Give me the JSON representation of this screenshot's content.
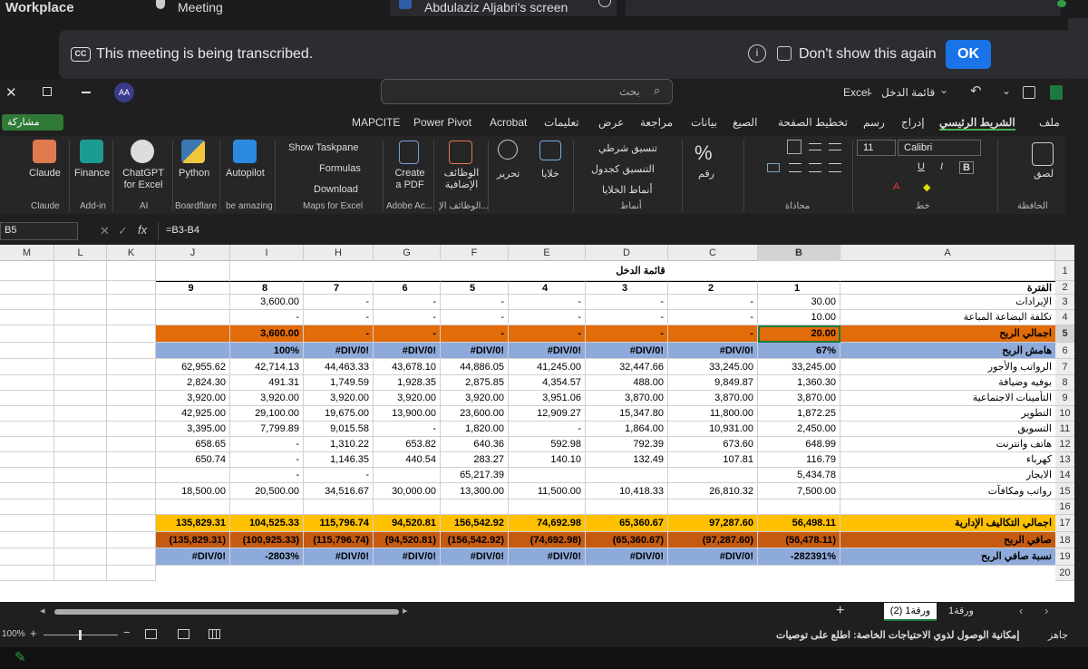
{
  "meeting": {
    "app_title": "Workplace",
    "tab1": "Meeting",
    "tab2": "Abdulaziz Aljabri's screen",
    "banner_text": "This meeting is being transcribed.",
    "cc_badge": "CC",
    "dont_show": "Don't show this again",
    "ok": "OK"
  },
  "excel": {
    "file_title": "قائمة الدخل",
    "app_name": "Excel",
    "search_placeholder": "بحث",
    "avatar": "AA",
    "share": "مشاركة",
    "menu": [
      "ملف",
      "الشريط الرئيسي",
      "إدراج",
      "رسم",
      "تخطيط الصفحة",
      "الصيغ",
      "بيانات",
      "مراجعة",
      "عرض",
      "تعليمات",
      "Acrobat",
      "Power Pivot",
      "MAPCITE"
    ],
    "ribbon": {
      "claude": "Claude",
      "finance": "Finance",
      "chatgpt": "ChatGPT for Excel",
      "python": "Python",
      "autopilot": "Autopilot",
      "show_taskpane": "Show Taskpane",
      "formulas": "Formulas",
      "download": "Download",
      "create_pdf": "Create a PDF",
      "addins": "الوظائف الإضافية",
      "edit": "تحرير",
      "cells": "خلايا",
      "cond_format": "تنسيق شرطي",
      "format_table": "التنسيق كجدول",
      "cell_styles": "أنماط الخلايا",
      "number": "رقم",
      "paste": "لصق",
      "font_name": "Calibri",
      "font_size": "11",
      "groups": [
        "Claude",
        "Add-in",
        "AI",
        "Boardflare",
        "be amazing",
        "Maps for Excel",
        "Adobe Ac...",
        "الوظائف الإ...",
        "أنماط",
        "محاذاة",
        "خط",
        "الحافظة"
      ]
    },
    "namebox": "B5",
    "formula": "=B3-B4",
    "columns": [
      "M",
      "L",
      "K",
      "J",
      "I",
      "H",
      "G",
      "F",
      "E",
      "D",
      "C",
      "B",
      "A"
    ],
    "rows": [
      "1",
      "2",
      "3",
      "4",
      "5",
      "6",
      "7",
      "8",
      "9",
      "10",
      "11",
      "12",
      "13",
      "14",
      "15",
      "16",
      "17",
      "18",
      "19",
      "20"
    ],
    "sheet_title": "قائمة الدخل",
    "periods": [
      "1",
      "2",
      "3",
      "4",
      "5",
      "6",
      "7",
      "8",
      "9"
    ],
    "period_label": "الفترة",
    "table": [
      {
        "label": "الإيرادات",
        "vals": [
          "30.00",
          "-",
          "-",
          "-",
          "-",
          "-",
          "-",
          "3,600.00",
          ""
        ]
      },
      {
        "label": "تكلفة البضاعة المباعة",
        "vals": [
          "10.00",
          "-",
          "-",
          "-",
          "-",
          "-",
          "-",
          "-",
          ""
        ]
      },
      {
        "label": "اجمالي الربح",
        "vals": [
          "20.00",
          "-",
          "-",
          "-",
          "-",
          "-",
          "-",
          "3,600.00",
          ""
        ]
      },
      {
        "label": "هامش الربح",
        "vals": [
          "67%",
          "#DIV/0!",
          "#DIV/0!",
          "#DIV/0!",
          "#DIV/0!",
          "#DIV/0!",
          "#DIV/0!",
          "100%",
          ""
        ]
      },
      {
        "label": "الرواتب والأجور",
        "vals": [
          "33,245.00",
          "33,245.00",
          "32,447.66",
          "41,245.00",
          "44,886.05",
          "43,678.10",
          "44,463.33",
          "42,714.13",
          "62,955.62"
        ]
      },
      {
        "label": "بوفيه وضيافة",
        "vals": [
          "1,360.30",
          "9,849.87",
          "488.00",
          "4,354.57",
          "2,875.85",
          "1,928.35",
          "1,749.59",
          "491.31",
          "2,824.30"
        ]
      },
      {
        "label": "التأمينات الاجتماعية",
        "vals": [
          "3,870.00",
          "3,870.00",
          "3,870.00",
          "3,951.06",
          "3,920.00",
          "3,920.00",
          "3,920.00",
          "3,920.00",
          "3,920.00"
        ]
      },
      {
        "label": "التطوير",
        "vals": [
          "1,872.25",
          "11,800.00",
          "15,347.80",
          "12,909.27",
          "23,600.00",
          "13,900.00",
          "19,675.00",
          "29,100.00",
          "42,925.00"
        ]
      },
      {
        "label": "التسويق",
        "vals": [
          "2,450.00",
          "10,931.00",
          "1,864.00",
          "-",
          "1,820.00",
          "-",
          "9,015.58",
          "7,799.89",
          "3,395.00"
        ]
      },
      {
        "label": "هاتف وانترنت",
        "vals": [
          "648.99",
          "673.60",
          "792.39",
          "592.98",
          "640.36",
          "653.82",
          "1,310.22",
          "-",
          "658.65"
        ]
      },
      {
        "label": "كهرباء",
        "vals": [
          "116.79",
          "107.81",
          "132.49",
          "140.10",
          "283.27",
          "440.54",
          "1,146.35",
          "-",
          "650.74"
        ]
      },
      {
        "label": "الايجار",
        "vals": [
          "5,434.78",
          "",
          "",
          "",
          "65,217.39",
          "",
          "-",
          "-",
          ""
        ]
      },
      {
        "label": "رواتب ومكافآت",
        "vals": [
          "7,500.00",
          "26,810.32",
          "10,418.33",
          "11,500.00",
          "13,300.00",
          "30,000.00",
          "34,516.67",
          "20,500.00",
          "18,500.00"
        ]
      },
      {
        "label": "",
        "vals": [
          "",
          "",
          "",
          "",
          "",
          "",
          "",
          "",
          ""
        ]
      },
      {
        "label": "اجمالي التكاليف الإدارية",
        "vals": [
          "56,498.11",
          "97,287.60",
          "65,360.67",
          "74,692.98",
          "156,542.92",
          "94,520.81",
          "115,796.74",
          "104,525.33",
          "135,829.31"
        ]
      },
      {
        "label": "صافي الربح",
        "vals": [
          "(56,478.11)",
          "(97,287.60)",
          "(65,360.67)",
          "(74,692.98)",
          "(156,542.92)",
          "(94,520.81)",
          "(115,796.74)",
          "(100,925.33)",
          "(135,829.31)"
        ]
      },
      {
        "label": "نسبة صافي الربح",
        "vals": [
          "-282391%",
          "#DIV/0!",
          "#DIV/0!",
          "#DIV/0!",
          "#DIV/0!",
          "#DIV/0!",
          "#DIV/0!",
          "-2803%",
          "#DIV/0!"
        ]
      }
    ],
    "sheets": [
      "ورقة1",
      "ورقة1 (2)"
    ],
    "zoom": "100%",
    "status_ready": "جاهز",
    "accessibility": "إمكانية الوصول لذوي الاحتياجات الخاصة: اطلع على توصيات"
  }
}
